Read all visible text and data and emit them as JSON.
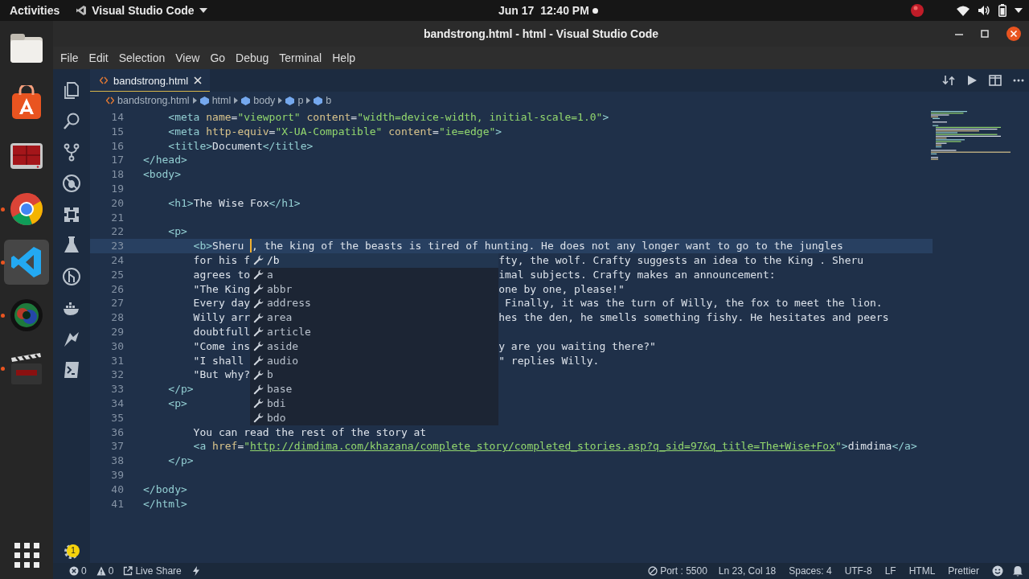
{
  "top_bar": {
    "activities": "Activities",
    "app_menu": "Visual Studio Code",
    "clock": "Jun 17  12:40 PM"
  },
  "dock": [
    {
      "running": false,
      "selected": false
    },
    {
      "running": false,
      "selected": false
    },
    {
      "running": false,
      "selected": false
    },
    {
      "running": true,
      "selected": false
    },
    {
      "running": true,
      "selected": true
    },
    {
      "running": true,
      "selected": false
    },
    {
      "running": true,
      "selected": false
    }
  ],
  "window": {
    "title": "bandstrong.html - html - Visual Studio Code"
  },
  "menu": [
    "File",
    "Edit",
    "Selection",
    "View",
    "Go",
    "Debug",
    "Terminal",
    "Help"
  ],
  "settings_badge": "1",
  "tabs": [
    {
      "label": "bandstrong.html",
      "selected": true
    }
  ],
  "breadcrumbs": [
    "bandstrong.html",
    "html",
    "body",
    "p",
    "b"
  ],
  "editor": {
    "lines": [
      {
        "number": "14",
        "tokens": [
          {
            "kind": "tag",
            "text": "    <meta"
          },
          {
            "kind": "attr",
            "text": " name"
          },
          {
            "kind": "punct",
            "text": "="
          },
          {
            "kind": "string",
            "text": "\"viewport\""
          },
          {
            "kind": "attr",
            "text": " content"
          },
          {
            "kind": "punct",
            "text": "="
          },
          {
            "kind": "string",
            "text": "\"width=device-width, initial-scale=1.0\""
          },
          {
            "kind": "tag",
            "text": ">"
          }
        ]
      },
      {
        "number": "15",
        "tokens": [
          {
            "kind": "tag",
            "text": "    <meta"
          },
          {
            "kind": "attr",
            "text": " http-equiv"
          },
          {
            "kind": "punct",
            "text": "="
          },
          {
            "kind": "string",
            "text": "\"X-UA-Compatible\""
          },
          {
            "kind": "attr",
            "text": " content"
          },
          {
            "kind": "punct",
            "text": "="
          },
          {
            "kind": "string",
            "text": "\"ie=edge\""
          },
          {
            "kind": "tag",
            "text": ">"
          }
        ]
      },
      {
        "number": "16",
        "tokens": [
          {
            "kind": "tag",
            "text": "    <title>"
          },
          {
            "kind": "text",
            "text": "Document"
          },
          {
            "kind": "tag",
            "text": "</title>"
          }
        ]
      },
      {
        "number": "17",
        "tokens": [
          {
            "kind": "tag",
            "text": "</head>"
          }
        ]
      },
      {
        "number": "18",
        "tokens": [
          {
            "kind": "tag",
            "text": "<body>"
          }
        ]
      },
      {
        "number": "19"
      },
      {
        "number": "20",
        "tokens": [
          {
            "kind": "tag",
            "text": "    <h1>"
          },
          {
            "kind": "text",
            "text": "The Wise Fox"
          },
          {
            "kind": "tag",
            "text": "</h1>"
          }
        ]
      },
      {
        "number": "21"
      },
      {
        "number": "22",
        "tokens": [
          {
            "kind": "tag",
            "text": "    <p>"
          }
        ]
      },
      {
        "number": "23",
        "current": true,
        "tokens": [
          {
            "kind": "tag",
            "text": "        <b>"
          },
          {
            "kind": "text",
            "text": "Sheru "
          }
        ],
        "cursor": true,
        "rest": [
          {
            "kind": "text",
            "text": ", the king of the beasts is tired of hunting. He does not any longer want to go to the jungles"
          }
        ]
      },
      {
        "number": "24",
        "tokens": [
          {
            "kind": "text",
            "text": "        for his f"
          }
        ],
        "after_popup": [
          {
            "kind": "text",
            "text": "fty, the wolf. Crafty suggests an idea to the King . Sheru"
          }
        ]
      },
      {
        "number": "25",
        "tokens": [
          {
            "kind": "text",
            "text": "        agrees to"
          }
        ],
        "after_popup": [
          {
            "kind": "text",
            "text": "imal subjects. Crafty makes an announcement:"
          }
        ]
      },
      {
        "number": "26",
        "tokens": [
          {
            "kind": "text",
            "text": "        \"The King"
          }
        ],
        "after_popup": [
          {
            "kind": "text",
            "text": "one by one, please!\""
          }
        ]
      },
      {
        "number": "27",
        "tokens": [
          {
            "kind": "text",
            "text": "        Every day"
          }
        ],
        "after_popup": [
          {
            "kind": "text",
            "text": " Finally, it was the turn of Willy, the fox to meet the lion."
          }
        ]
      },
      {
        "number": "28",
        "tokens": [
          {
            "kind": "text",
            "text": "        Willy arr"
          }
        ],
        "after_popup": [
          {
            "kind": "text",
            "text": "hes the den, he smells something fishy. He hesitates and peers"
          }
        ]
      },
      {
        "number": "29",
        "tokens": [
          {
            "kind": "text",
            "text": "        doubtfull"
          }
        ]
      },
      {
        "number": "30",
        "tokens": [
          {
            "kind": "text",
            "text": "        \"Come ins"
          }
        ],
        "after_popup": [
          {
            "kind": "text",
            "text": "y are you waiting there?\""
          }
        ]
      },
      {
        "number": "31",
        "tokens": [
          {
            "kind": "text",
            "text": "        \"I shall"
          }
        ],
        "after_popup": [
          {
            "kind": "text",
            "text": "\" replies Willy."
          }
        ]
      },
      {
        "number": "32",
        "tokens": [
          {
            "kind": "text",
            "text": "        \"But why?"
          }
        ]
      },
      {
        "number": "33",
        "tokens": [
          {
            "kind": "tag",
            "text": "    </p>"
          }
        ]
      },
      {
        "number": "34",
        "tokens": [
          {
            "kind": "tag",
            "text": "    <p>"
          }
        ]
      },
      {
        "number": "35"
      },
      {
        "number": "36",
        "tokens": [
          {
            "kind": "text",
            "text": "        You can read the rest of the story at"
          }
        ]
      },
      {
        "number": "37",
        "tokens": [
          {
            "kind": "tag",
            "text": "        <a"
          },
          {
            "kind": "attr",
            "text": " href"
          },
          {
            "kind": "punct",
            "text": "="
          },
          {
            "kind": "string",
            "text": "\""
          },
          {
            "kind": "link",
            "text": "http://dimdima.com/khazana/complete_story/completed_stories.asp?q_sid=97&q_title=The+Wise+Fox"
          },
          {
            "kind": "string",
            "text": "\""
          },
          {
            "kind": "tag",
            "text": ">"
          },
          {
            "kind": "text",
            "text": "dimdima"
          },
          {
            "kind": "tag",
            "text": "</a>"
          }
        ]
      },
      {
        "number": "38",
        "tokens": [
          {
            "kind": "tag",
            "text": "    </p>"
          }
        ]
      },
      {
        "number": "39"
      },
      {
        "number": "40",
        "tokens": [
          {
            "kind": "tag",
            "text": "</body>"
          }
        ]
      },
      {
        "number": "41",
        "tokens": [
          {
            "kind": "tag",
            "text": "</html>"
          }
        ]
      }
    ]
  },
  "suggestions": [
    {
      "label": "/b",
      "selected": true
    },
    {
      "label": "a",
      "selected": false
    },
    {
      "label": "abbr",
      "selected": false
    },
    {
      "label": "address",
      "selected": false
    },
    {
      "label": "area",
      "selected": false
    },
    {
      "label": "article",
      "selected": false
    },
    {
      "label": "aside",
      "selected": false
    },
    {
      "label": "audio",
      "selected": false
    },
    {
      "label": "b",
      "selected": false
    },
    {
      "label": "base",
      "selected": false
    },
    {
      "label": "bdi",
      "selected": false
    },
    {
      "label": "bdo",
      "selected": false
    }
  ],
  "status_bar": {
    "errors": "0",
    "warnings": "0",
    "live_share": "Live Share",
    "port": "Port : 5500",
    "position": "Ln 23, Col 18",
    "spaces": "Spaces: 4",
    "encoding": "UTF-8",
    "eol": "LF",
    "language": "HTML",
    "formatter": "Prettier"
  }
}
